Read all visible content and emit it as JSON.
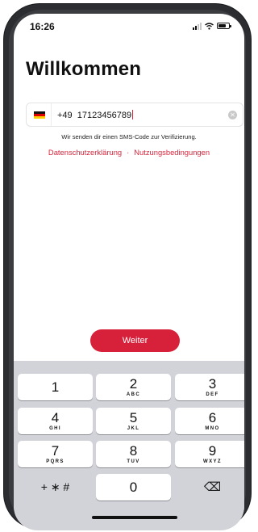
{
  "status_bar": {
    "time": "16:26"
  },
  "title": "Willkommen",
  "phone": {
    "country_code": "+49",
    "number": "17123456789",
    "clear_icon": "✕"
  },
  "hint": "Wir senden dir einen SMS-Code zur Verifizierung.",
  "links": {
    "privacy": "Datenschutzerklärung",
    "separator": "·",
    "terms": "Nutzungsbedingungen"
  },
  "continue_button": "Weiter",
  "keypad": {
    "keys": [
      {
        "num": "1",
        "letters": ""
      },
      {
        "num": "2",
        "letters": "ABC"
      },
      {
        "num": "3",
        "letters": "DEF"
      },
      {
        "num": "4",
        "letters": "GHI"
      },
      {
        "num": "5",
        "letters": "JKL"
      },
      {
        "num": "6",
        "letters": "MNO"
      },
      {
        "num": "7",
        "letters": "PQRS"
      },
      {
        "num": "8",
        "letters": "TUV"
      },
      {
        "num": "9",
        "letters": "WXYZ"
      }
    ],
    "symbols": "+ ∗ #",
    "zero": "0",
    "delete_icon": "⌫"
  },
  "colors": {
    "accent": "#d7213a",
    "keyboard_bg": "#d1d3d9"
  }
}
